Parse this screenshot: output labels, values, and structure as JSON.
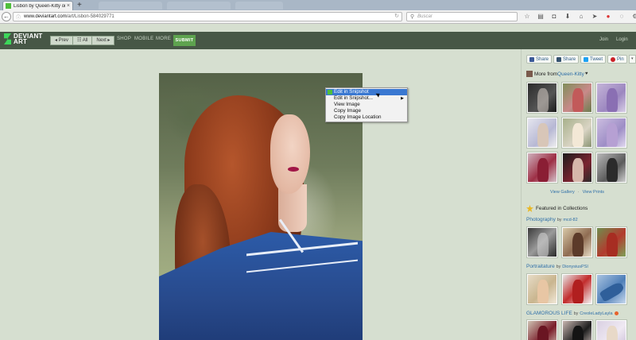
{
  "browser": {
    "active_tab_title": "Lisbon by Queen-Kitty on ...",
    "new_tab_label": "+",
    "url_domain": "www.deviantart.com",
    "url_path": "/art/Lisbon-584029771",
    "search_placeholder": "Buscar"
  },
  "header": {
    "logo_line1": "DEVIANT",
    "logo_line2": "ART",
    "prev_label": "◂ Prev",
    "all_label": "☷ All",
    "next_label": "Next ▸",
    "nav_links": [
      "SHOP",
      "MOBILE",
      "MORE"
    ],
    "submit_label": "SUBMIT",
    "join_label": "Join",
    "login_label": "Login"
  },
  "context_menu": {
    "items": [
      {
        "label": "Edit in Snipshot",
        "highlighted": true,
        "has_icon": true
      },
      {
        "label": "Edit in Snipshot...",
        "submenu": true
      },
      {
        "label": "View Image"
      },
      {
        "label": "Copy Image"
      },
      {
        "label": "Copy Image Location"
      }
    ]
  },
  "sidebar": {
    "share_buttons": [
      {
        "label": "Share",
        "color": "#3b5998"
      },
      {
        "label": "Share",
        "color": "#34526f"
      },
      {
        "label": "Tweet",
        "color": "#1da1f2"
      },
      {
        "label": "Pin",
        "color": "#cb2027"
      }
    ],
    "more_from_prefix": "More from ",
    "more_from_user": "Queen-Kitty",
    "heart": "♥",
    "view_gallery": "View Gallery",
    "link_separator": "·",
    "view_prints": "View Prints",
    "featured_title": "Featured in Collections",
    "by_word": "by",
    "collections": [
      {
        "name": "Photography",
        "user": "mcd-82"
      },
      {
        "name": "Portraitature",
        "user": "DionysiusPSI"
      },
      {
        "name": "GLAMOROUS LIFE",
        "user": "CreoleLadyLayla"
      }
    ]
  }
}
